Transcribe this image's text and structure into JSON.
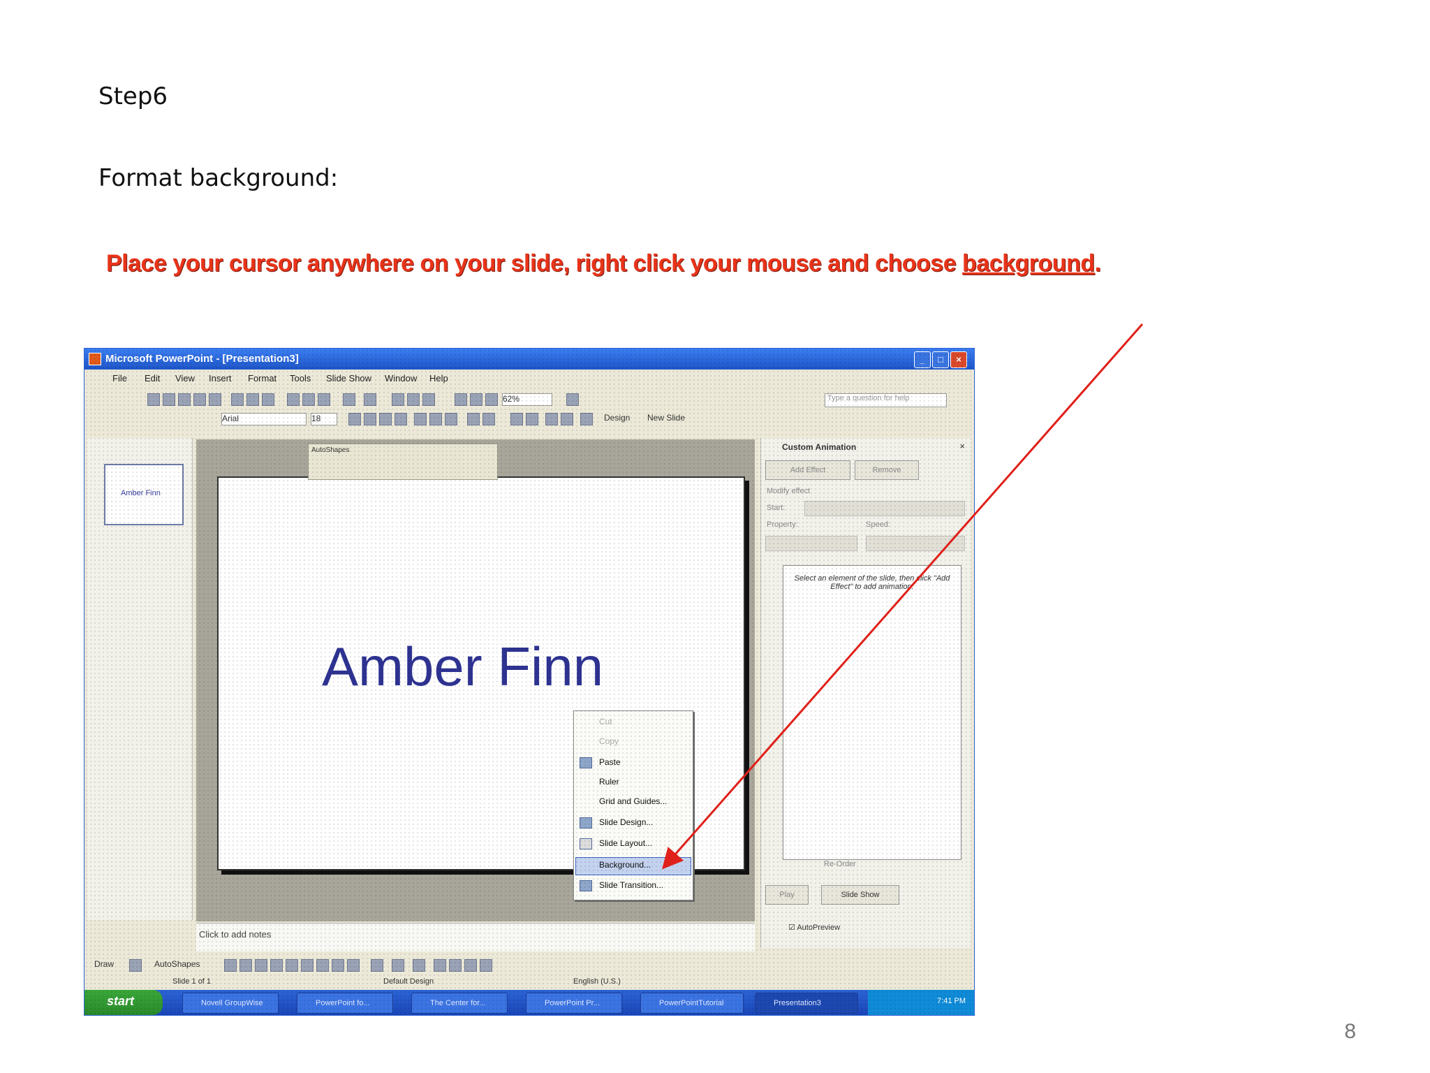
{
  "document": {
    "step": "Step6",
    "subtitle": "Format background:",
    "instruction_prefix": "Place your cursor anywhere on your slide, right click your mouse and choose ",
    "instruction_keyword": "background",
    "instruction_suffix": ".",
    "page_number": "8",
    "accent_color": "#e8341a"
  },
  "screenshot": {
    "window_title": "Microsoft PowerPoint - [Presentation3]",
    "menu": [
      "File",
      "Edit",
      "View",
      "Insert",
      "Format",
      "Tools",
      "Slide Show",
      "Window",
      "Help"
    ],
    "search_placeholder": "Type a question for help",
    "zoom": "62%",
    "font_name": "Arial",
    "font_size": "18",
    "toolbar_design": "Design",
    "toolbar_new_slide": "New Slide",
    "thumbnail_text": "Amber Finn",
    "autoshapes_title": "AutoShapes",
    "slide_title": "Amber Finn",
    "notes_placeholder": "Click to add notes",
    "context_menu": {
      "items": [
        {
          "label": "Cut",
          "disabled": true
        },
        {
          "label": "Copy",
          "disabled": true
        },
        {
          "label": "Paste",
          "disabled": false
        },
        {
          "label": "Ruler",
          "disabled": false
        },
        {
          "label": "Grid and Guides...",
          "disabled": false
        },
        {
          "label": "Slide Design...",
          "disabled": false
        },
        {
          "label": "Slide Layout...",
          "disabled": false
        },
        {
          "label": "Background...",
          "disabled": false,
          "highlighted": true
        },
        {
          "label": "Slide Transition...",
          "disabled": false
        }
      ]
    },
    "task_pane": {
      "title": "Custom Animation",
      "add_effect": "Add Effect",
      "remove": "Remove",
      "modify_label": "Modify effect",
      "start_label": "Start:",
      "property_label": "Property:",
      "speed_label": "Speed:",
      "hint": "Select an element of the slide, then click \"Add Effect\" to add animation.",
      "reorder": "Re-Order",
      "play": "Play",
      "slide_show": "Slide Show",
      "autopreview": "AutoPreview"
    },
    "drawing_bar": {
      "draw": "Draw",
      "autoshapes": "AutoShapes"
    },
    "status": {
      "slide": "Slide 1 of 1",
      "design": "Default Design",
      "language": "English (U.S.)"
    },
    "taskbar": {
      "start": "start",
      "items": [
        "Novell GroupWise",
        "PowerPoint fo...",
        "The Center for...",
        "PowerPoint Pr...",
        "PowerPointTutorial",
        "Presentation3"
      ],
      "clock": "7:41 PM"
    }
  }
}
